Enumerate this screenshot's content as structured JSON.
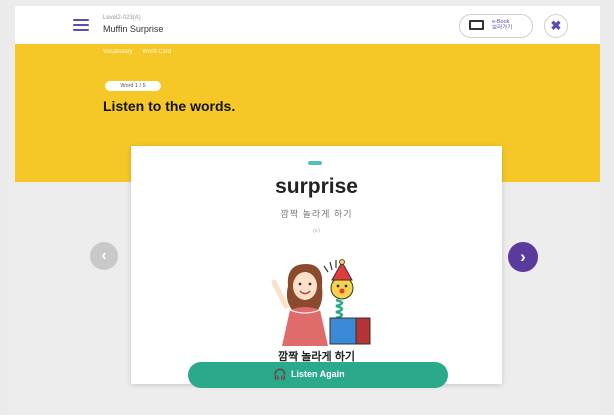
{
  "header": {
    "level": "Level2-023(A)",
    "title": "Muffin Surprise",
    "ebook_label": "e-Book\n보러가기",
    "close_glyph": "✖"
  },
  "breadcrumb": {
    "items": [
      "Vocabulary",
      "Word Card"
    ]
  },
  "progress": {
    "label": "Word 1 / 5",
    "current": 1,
    "total": 5
  },
  "instruction": "Listen to the words.",
  "card": {
    "word": "surprise",
    "meaning": "깜짝 놀라게 하기",
    "part_of_speech": "(v.)",
    "caption": "깜짝 놀라게 하기"
  },
  "listen_button": {
    "label": "Listen Again",
    "icon": "headphones-icon"
  },
  "nav": {
    "prev_glyph": "‹",
    "next_glyph": "›"
  },
  "colors": {
    "banner": "#f6c827",
    "accent": "#5b3a9e",
    "button": "#2aaa8a",
    "disabled": "#c9c9c9"
  }
}
